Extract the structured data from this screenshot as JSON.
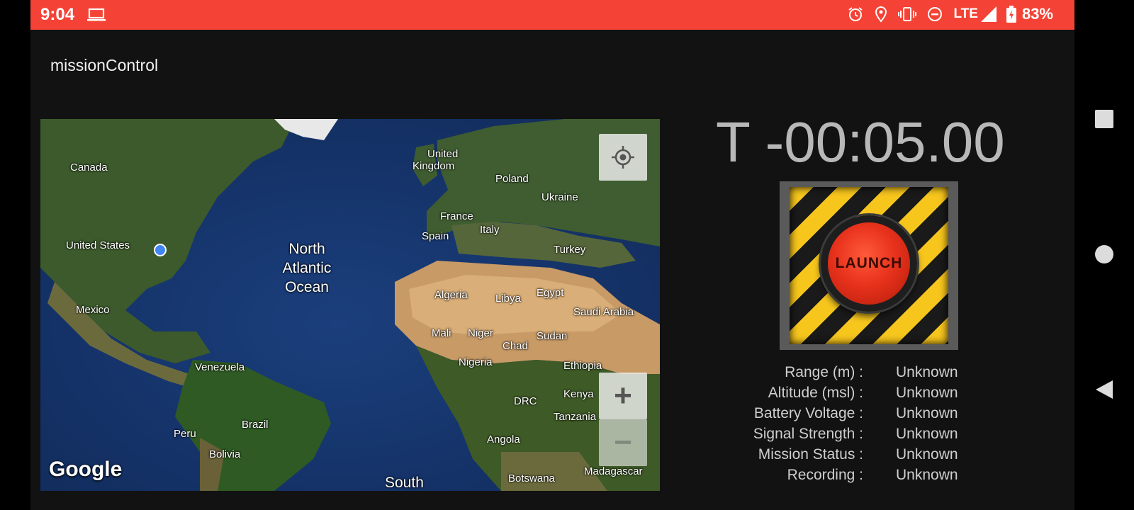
{
  "status_bar": {
    "time": "9:04",
    "network": "LTE",
    "battery": "83%",
    "bg_color": "#f44336"
  },
  "app": {
    "title": "missionControl"
  },
  "map": {
    "labels": {
      "canada": "Canada",
      "united_states": "United States",
      "mexico": "Mexico",
      "venezuela": "Venezuela",
      "brazil": "Brazil",
      "peru": "Peru",
      "bolivia": "Bolivia",
      "uk_1": "United",
      "uk_2": "Kingdom",
      "poland": "Poland",
      "ukraine": "Ukraine",
      "france": "France",
      "spain": "Spain",
      "italy": "Italy",
      "turkey": "Turkey",
      "algeria": "Algeria",
      "libya": "Libya",
      "egypt": "Egypt",
      "saudi": "Saudi Arabia",
      "mali": "Mali",
      "niger": "Niger",
      "chad": "Chad",
      "sudan": "Sudan",
      "nigeria": "Nigeria",
      "ethiopia": "Ethiopia",
      "kenya": "Kenya",
      "drc": "DRC",
      "tanzania": "Tanzania",
      "angola": "Angola",
      "botswana": "Botswana",
      "madagascar": "Madagascar",
      "ocean_1": "North",
      "ocean_2": "Atlantic",
      "ocean_3": "Ocean",
      "south": "South"
    },
    "logo": "Google",
    "controls": {
      "zoom_in": "+",
      "zoom_out": "−"
    }
  },
  "timer": "T -00:05.00",
  "launch_button": "LAUNCH",
  "stats": [
    {
      "label": "Range (m) :",
      "value": "Unknown"
    },
    {
      "label": "Altitude (msl) :",
      "value": "Unknown"
    },
    {
      "label": "Battery Voltage :",
      "value": "Unknown"
    },
    {
      "label": "Signal Strength :",
      "value": "Unknown"
    },
    {
      "label": "Mission Status :",
      "value": "Unknown"
    },
    {
      "label": "Recording :",
      "value": "Unknown"
    }
  ],
  "icons": [
    "laptop-icon",
    "alarm-icon",
    "location-icon",
    "vibrate-icon",
    "dnd-icon",
    "signal-icon",
    "battery-icon",
    "my-location-icon",
    "square-icon",
    "circle-icon",
    "back-triangle-icon"
  ]
}
